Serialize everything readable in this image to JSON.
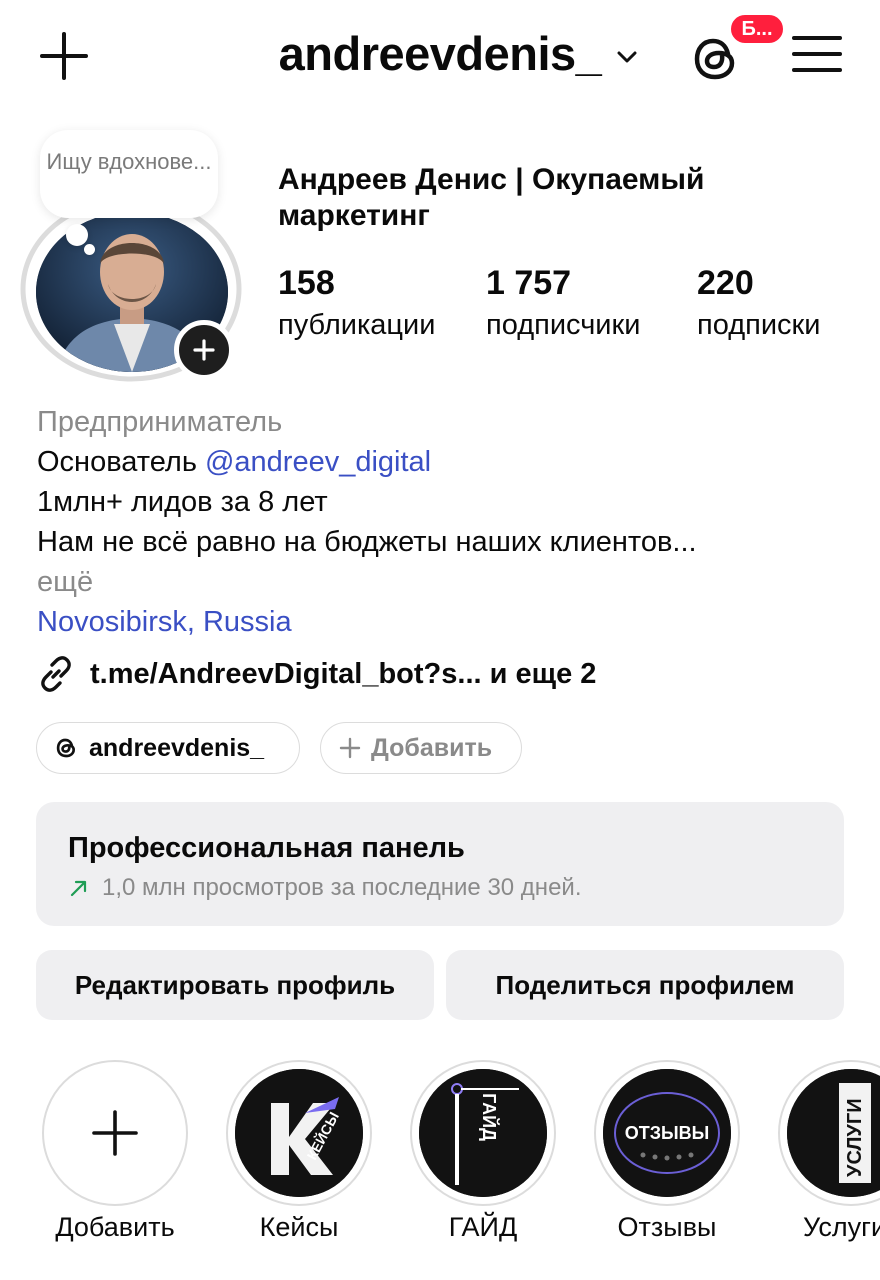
{
  "header": {
    "username": "andreevdenis_",
    "notification_badge": "Б..."
  },
  "profile": {
    "note": "Ищу вдохнове...",
    "display_name": "Андреев Денис | Окупаемый маркетинг",
    "stats": [
      {
        "value": "158",
        "label": "публикации"
      },
      {
        "value": "1 757",
        "label": "подписчики"
      },
      {
        "value": "220",
        "label": "подписки"
      }
    ],
    "category": "Предприниматель",
    "bio": {
      "line1_prefix": "Основатель ",
      "mention": "@andreev_digital",
      "line2": "1млн+ лидов за 8 лет",
      "line3": "Нам не всё равно на бюджеты наших клиентов...",
      "more": "ещё"
    },
    "location": "Novosibirsk, Russia",
    "link": "t.me/AndreevDigital_bot?s...  и еще 2"
  },
  "chips": {
    "threads_handle": "andreevdenis_",
    "add_label": "Добавить"
  },
  "pro_panel": {
    "title": "Профессиональная панель",
    "subtitle": "1,0 млн просмотров за последние 30 дней."
  },
  "buttons": {
    "edit": "Редактировать профиль",
    "share": "Поделиться профилем"
  },
  "highlights": [
    {
      "label": "Добавить",
      "icon": "plus-icon"
    },
    {
      "label": "Кейсы",
      "cover_text": "КЕЙСЫ"
    },
    {
      "label": "ГАЙД",
      "cover_text": "ГАЙД"
    },
    {
      "label": "Отзывы",
      "cover_text": "ОТЗЫВЫ"
    },
    {
      "label": "Услуги",
      "cover_text": "УСЛУГИ"
    }
  ],
  "colors": {
    "link_blue": "#3a4fc4",
    "badge_red": "#ff1f3d",
    "panel_grey": "#efeff1",
    "trend_green": "#1f9d55"
  }
}
